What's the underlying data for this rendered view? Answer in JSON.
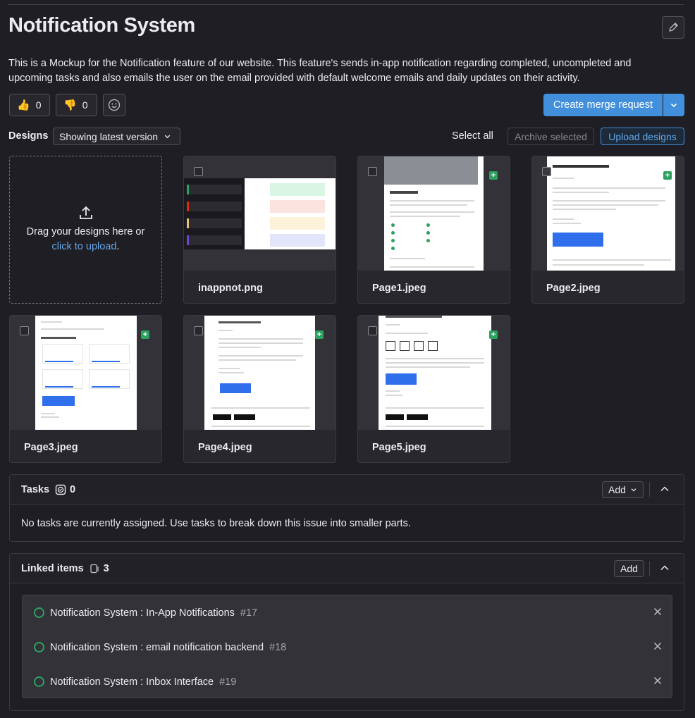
{
  "issue": {
    "title": "Notification System",
    "description": "This is a Mockup for the Notification feature of our website. This feature's sends in-app notification regarding completed, uncompleted and upcoming tasks and also emails the user on the email provided with default welcome emails and daily updates on their activity."
  },
  "reactions": {
    "thumbs_up_count": "0",
    "thumbs_down_count": "0"
  },
  "merge_request": {
    "label": "Create merge request"
  },
  "designs": {
    "label": "Designs",
    "version": "Showing latest version",
    "select_all": "Select all",
    "archive": "Archive selected",
    "upload": "Upload designs",
    "drop_text": "Drag your designs here or",
    "drop_link": "click to upload",
    "drop_period": ".",
    "items": [
      {
        "name": "inappnot.png"
      },
      {
        "name": "Page1.jpeg"
      },
      {
        "name": "Page2.jpeg"
      },
      {
        "name": "Page3.jpeg"
      },
      {
        "name": "Page4.jpeg"
      },
      {
        "name": "Page5.jpeg"
      }
    ]
  },
  "tasks": {
    "title": "Tasks",
    "count": "0",
    "add": "Add",
    "empty": "No tasks are currently assigned. Use tasks to break down this issue into smaller parts."
  },
  "linked": {
    "title": "Linked items",
    "count": "3",
    "add": "Add",
    "items": [
      {
        "title": "Notification System : In-App Notifications",
        "ref": "#17"
      },
      {
        "title": "Notification System : email notification backend",
        "ref": "#18"
      },
      {
        "title": "Notification System : Inbox Interface",
        "ref": "#19"
      }
    ]
  },
  "colors": {
    "background": "#1f1e24",
    "accent": "#428fdc",
    "link": "#63a6e9",
    "success": "#2da160"
  }
}
